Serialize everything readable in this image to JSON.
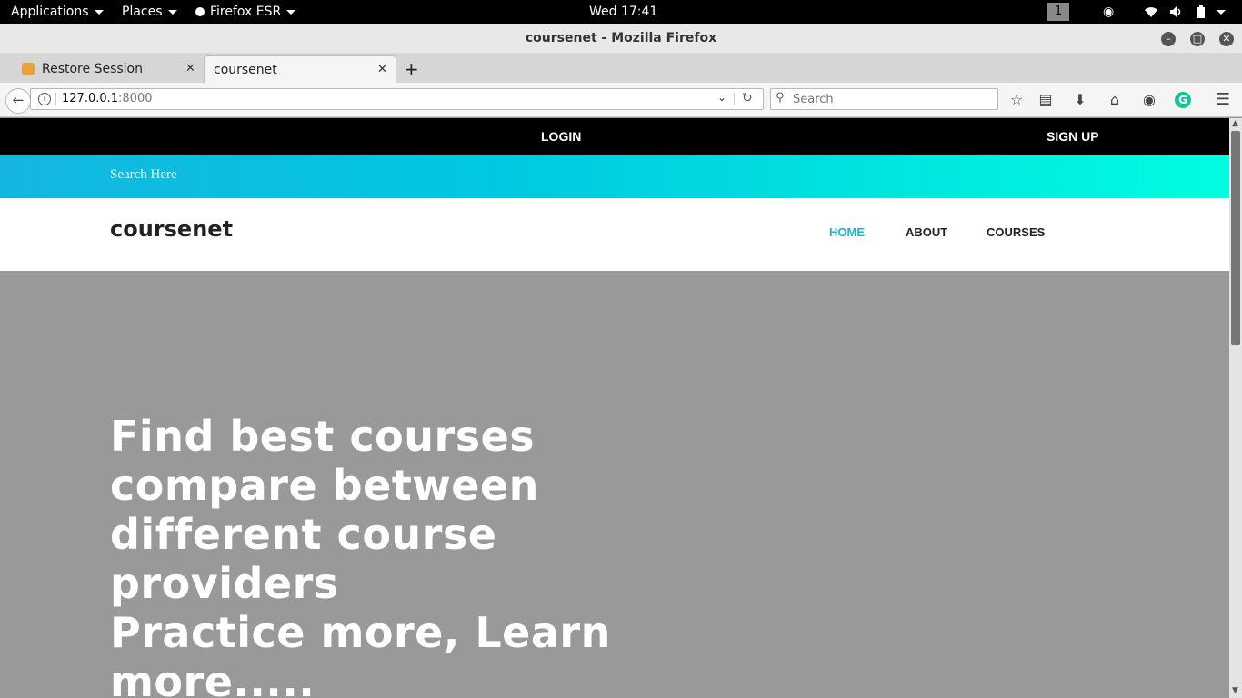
{
  "gnome": {
    "applications": "Applications",
    "places": "Places",
    "app_menu": "Firefox ESR",
    "clock": "Wed 17:41",
    "workspace": "1"
  },
  "window": {
    "title": "coursenet - Mozilla Firefox"
  },
  "tabs": [
    {
      "label": "Restore Session",
      "active": false
    },
    {
      "label": "coursenet",
      "active": true
    }
  ],
  "toolbar": {
    "url_host": "127.0.0.1",
    "url_port": ":8000",
    "search_placeholder": "Search"
  },
  "site": {
    "login": "LOGIN",
    "signup": "SIGN UP",
    "search_placeholder": "Search Here",
    "brand": "coursenet",
    "nav": [
      "HOME",
      "ABOUT",
      "COURSES"
    ],
    "active_nav": "HOME",
    "accent_color": "#1ab3d3",
    "hero_lines": [
      "Find best courses",
      "compare between",
      "different course",
      "providers",
      "Practice more, Learn",
      "more....."
    ]
  }
}
